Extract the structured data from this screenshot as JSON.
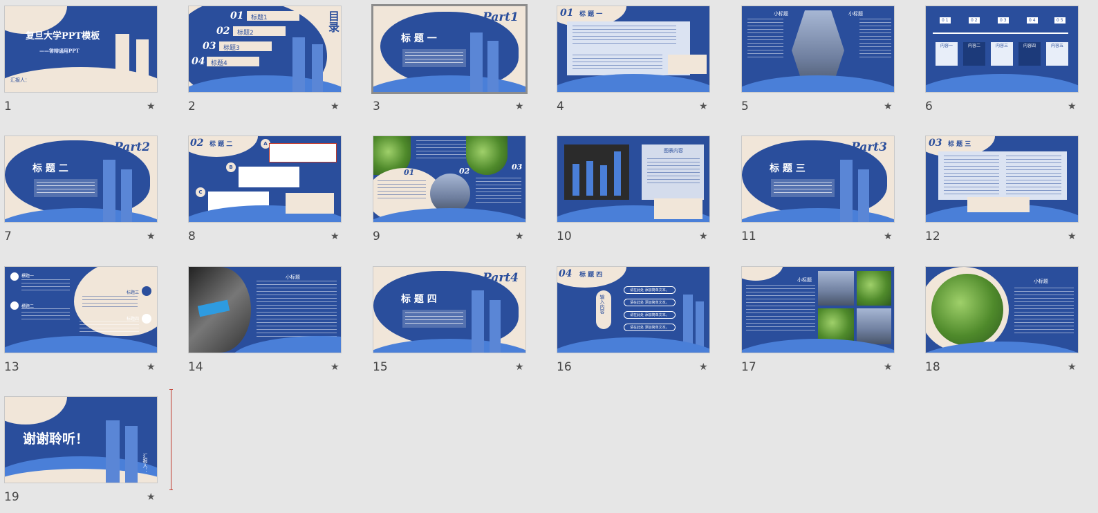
{
  "slides": [
    {
      "number": "1",
      "title": "复旦大学PPT模板",
      "subtitle": "——答辩通用PPT",
      "footer": "汇报人："
    },
    {
      "number": "2",
      "items": [
        {
          "idx": "01",
          "label": "标题1"
        },
        {
          "idx": "02",
          "label": "标题2"
        },
        {
          "idx": "03",
          "label": "标题3"
        },
        {
          "idx": "04",
          "label": "标题4"
        }
      ],
      "heading": "目录"
    },
    {
      "number": "3",
      "part": "Part1",
      "title": "标 题 一"
    },
    {
      "number": "4",
      "idx": "01",
      "title": "标 题 一"
    },
    {
      "number": "5",
      "label_left": "小标题",
      "label_right": "小标题"
    },
    {
      "number": "6",
      "steps": [
        "0 1",
        "0 2",
        "0 3",
        "0 4",
        "0 5"
      ],
      "cards": [
        "内容一",
        "内容二",
        "内容三",
        "内容四",
        "内容五"
      ]
    },
    {
      "number": "7",
      "part": "Part2",
      "title": "标 题 二"
    },
    {
      "number": "8",
      "idx": "02",
      "title": "标 题 二",
      "markers": [
        "A",
        "B",
        "C"
      ]
    },
    {
      "number": "9",
      "labels": [
        "01",
        "02",
        "03"
      ]
    },
    {
      "number": "10",
      "panel_title": "图表内容"
    },
    {
      "number": "11",
      "part": "Part3",
      "title": "标 题 三"
    },
    {
      "number": "12",
      "idx": "03",
      "title": "标 题 三"
    },
    {
      "number": "13",
      "left": [
        "標题一",
        "標题二"
      ],
      "right": [
        "标题三",
        "标题四"
      ]
    },
    {
      "number": "14",
      "label": "小标题"
    },
    {
      "number": "15",
      "part": "Part4",
      "title": "标 题 四"
    },
    {
      "number": "16",
      "idx": "04",
      "title": "标 题 四",
      "center": "输入内容",
      "rows": [
        "请在此处 添加简单文本。",
        "请在此处 添加简单文本。",
        "请在此处 添加简单文本。",
        "请在此处 添加简单文本。"
      ]
    },
    {
      "number": "17",
      "label": "小标题"
    },
    {
      "number": "18",
      "label": "小标题"
    },
    {
      "number": "19",
      "title": "谢谢聆听！",
      "footer": "汇报人："
    }
  ],
  "star_glyph": "★",
  "selected_slide": "3",
  "colors": {
    "accent": "#2a4e9c",
    "cream": "#f1e6d9",
    "light_blue": "#4a7fd8",
    "background": "#e6e6e6"
  }
}
